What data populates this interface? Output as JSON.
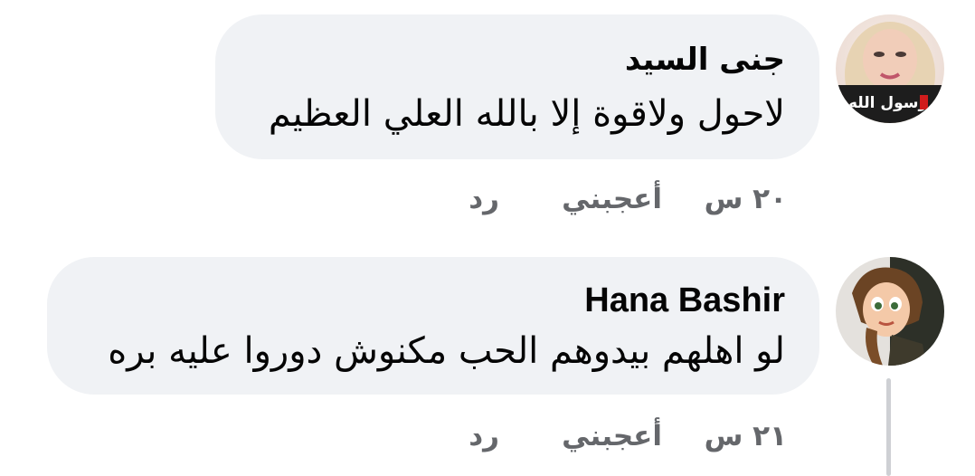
{
  "comments": [
    {
      "author": "جنى السيد",
      "text": "لاحول ولاقوة إلا بالله العلي العظيم",
      "time": "٢٠ س",
      "like_label": "أعجبني",
      "reply_label": "رد",
      "avatar_badge": "رسول الله",
      "avatar_icon": "woman-in-hijab-portrait"
    },
    {
      "author": "Hana Bashir",
      "text": "لو اهلهم بيدوهم الحب مكنوش دوروا عليه بره",
      "time": "٢١ س",
      "like_label": "أعجبني",
      "reply_label": "رد",
      "avatar_icon": "cartoon-girl-portrait"
    }
  ],
  "colors": {
    "bubble": "#f0f2f5",
    "text": "#050505",
    "meta": "#65676b",
    "thread_line": "#ced0d4"
  }
}
